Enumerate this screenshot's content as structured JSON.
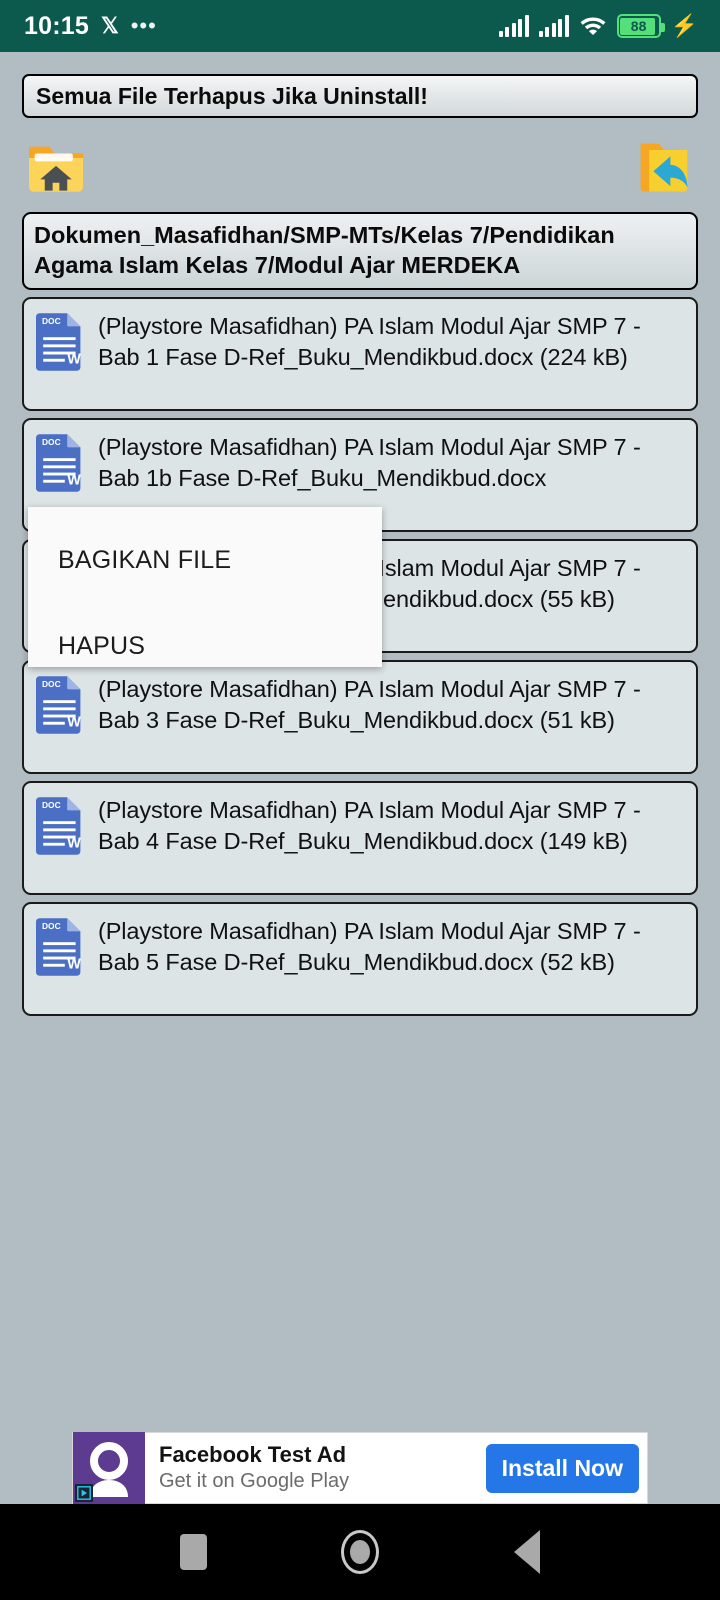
{
  "status_bar": {
    "time": "10:15",
    "app_icon": "𝕏",
    "more_icon": "•••",
    "battery_percent": "88",
    "battery_level": 88,
    "charging": true,
    "signal_icon": "signal-bars",
    "wifi_icon": "wifi-icon",
    "background_color": "#0c5a4d"
  },
  "banner": {
    "text": "Semua File Terhapus Jika Uninstall!"
  },
  "toolbar": {
    "home_label": "home-folder",
    "back_label": "back-folder"
  },
  "path": {
    "text": "Dokumen_Masafidhan/SMP-MTs/Kelas 7/Pendidikan Agama Islam Kelas 7/Modul Ajar MERDEKA"
  },
  "files": [
    {
      "name": "(Playstore Masafidhan) PA Islam Modul Ajar SMP 7 - Bab 1 Fase D-Ref_Buku_Mendikbud.docx (224 kB)",
      "size": "224 kB",
      "icon": "docx-icon"
    },
    {
      "name": "(Playstore Masafidhan) PA Islam Modul Ajar SMP 7 - Bab 1b Fase D-Ref_Buku_Mendikbud.docx",
      "size": "",
      "icon": "docx-icon"
    },
    {
      "name": "(Playstore Masafidhan) PA Islam Modul Ajar SMP 7 - Bab 2 Fase D-Ref_Buku_Mendikbud.docx (55 kB)",
      "size": "55 kB",
      "icon": "docx-icon"
    },
    {
      "name": "(Playstore Masafidhan) PA Islam Modul Ajar SMP 7 - Bab 3 Fase D-Ref_Buku_Mendikbud.docx (51 kB)",
      "size": "51 kB",
      "icon": "docx-icon"
    },
    {
      "name": "(Playstore Masafidhan) PA Islam Modul Ajar SMP 7 - Bab 4 Fase D-Ref_Buku_Mendikbud.docx (149 kB)",
      "size": "149 kB",
      "icon": "docx-icon"
    },
    {
      "name": "(Playstore Masafidhan) PA Islam Modul Ajar SMP 7 - Bab 5 Fase D-Ref_Buku_Mendikbud.docx (52 kB)",
      "size": "52 kB",
      "icon": "docx-icon"
    }
  ],
  "context_menu": {
    "share_label": "BAGIKAN FILE",
    "delete_label": "HAPUS"
  },
  "ad": {
    "title": "Facebook Test Ad",
    "subtitle": "Get it on Google Play",
    "cta_label": "Install Now",
    "cta_color": "#2577e8",
    "icon_color": "#5c3b91",
    "adchoices_icon": "adchoices-icon"
  },
  "nav_bar": {
    "recents_label": "recents",
    "home_label": "home",
    "back_label": "back"
  }
}
